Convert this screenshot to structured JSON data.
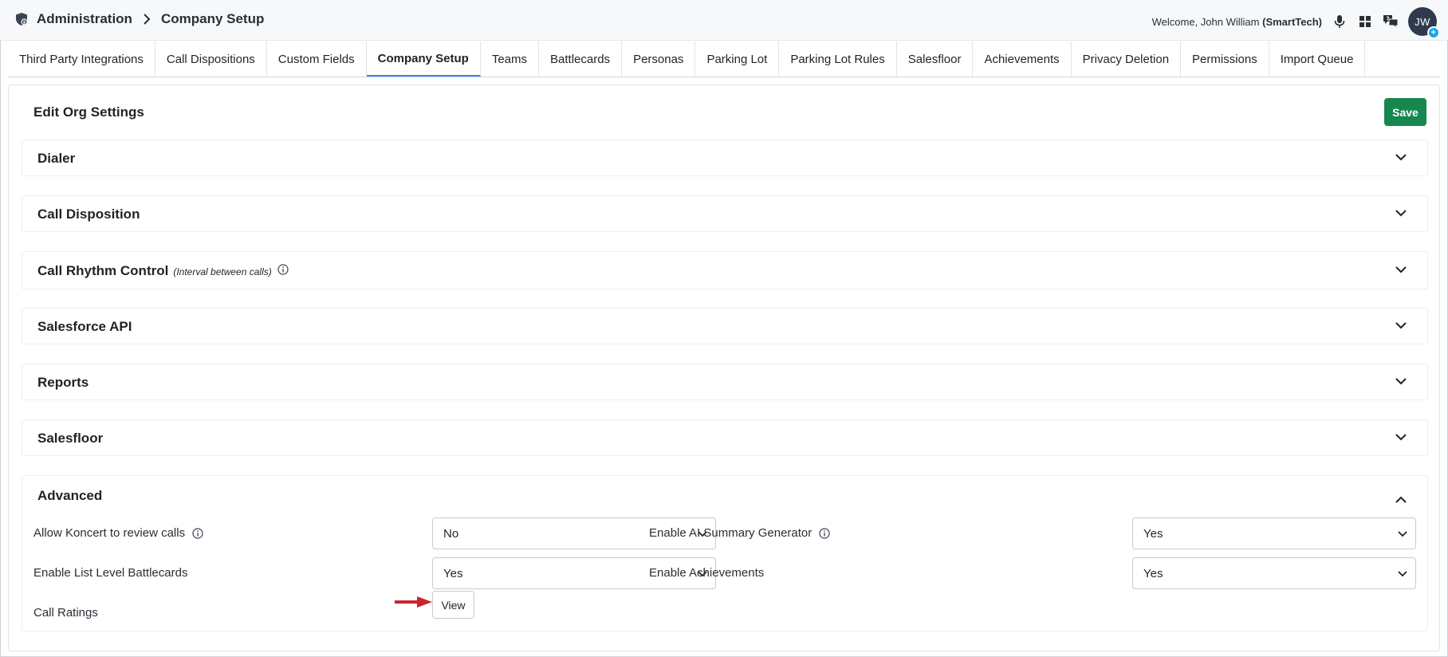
{
  "header": {
    "breadcrumb_root": "Administration",
    "breadcrumb_current": "Company Setup",
    "welcome_prefix": "Welcome, John William",
    "org": "(SmartTech)",
    "avatar_initials": "JW",
    "avatar_badge": "+",
    "icons": [
      "shield-icon",
      "chevron-right-icon",
      "microphone-icon",
      "grid-icon",
      "chat-icon"
    ]
  },
  "tabs": [
    {
      "label": "Third Party Integrations",
      "active": false
    },
    {
      "label": "Call Dispositions",
      "active": false
    },
    {
      "label": "Custom Fields",
      "active": false
    },
    {
      "label": "Company Setup",
      "active": true
    },
    {
      "label": "Teams",
      "active": false
    },
    {
      "label": "Battlecards",
      "active": false
    },
    {
      "label": "Personas",
      "active": false
    },
    {
      "label": "Parking Lot",
      "active": false
    },
    {
      "label": "Parking Lot Rules",
      "active": false
    },
    {
      "label": "Salesfloor",
      "active": false
    },
    {
      "label": "Achievements",
      "active": false
    },
    {
      "label": "Privacy Deletion",
      "active": false
    },
    {
      "label": "Permissions",
      "active": false
    },
    {
      "label": "Import Queue",
      "active": false
    }
  ],
  "card": {
    "title": "Edit Org Settings",
    "save_label": "Save"
  },
  "sections": {
    "dialer": "Dialer",
    "call_disposition": "Call Disposition",
    "call_rhythm": "Call Rhythm Control",
    "call_rhythm_sub": "(Interval between calls)",
    "salesforce_api": "Salesforce API",
    "reports": "Reports",
    "salesfloor": "Salesfloor",
    "advanced": "Advanced"
  },
  "advanced": {
    "allow_review_label": "Allow Koncert to review calls",
    "allow_review_value": "No",
    "ai_summary_label": "Enable AI Summary Generator",
    "ai_summary_value": "Yes",
    "list_battlecards_label": "Enable List Level Battlecards",
    "list_battlecards_value": "Yes",
    "achievements_label": "Enable Achievements",
    "achievements_value": "Yes",
    "call_ratings_label": "Call Ratings",
    "view_label": "View"
  },
  "colors": {
    "accent": "#3b82f6",
    "save": "#16874f",
    "arrow": "#c8262c",
    "avatar": "#2f3b4c",
    "badge": "#1aa3e8"
  }
}
